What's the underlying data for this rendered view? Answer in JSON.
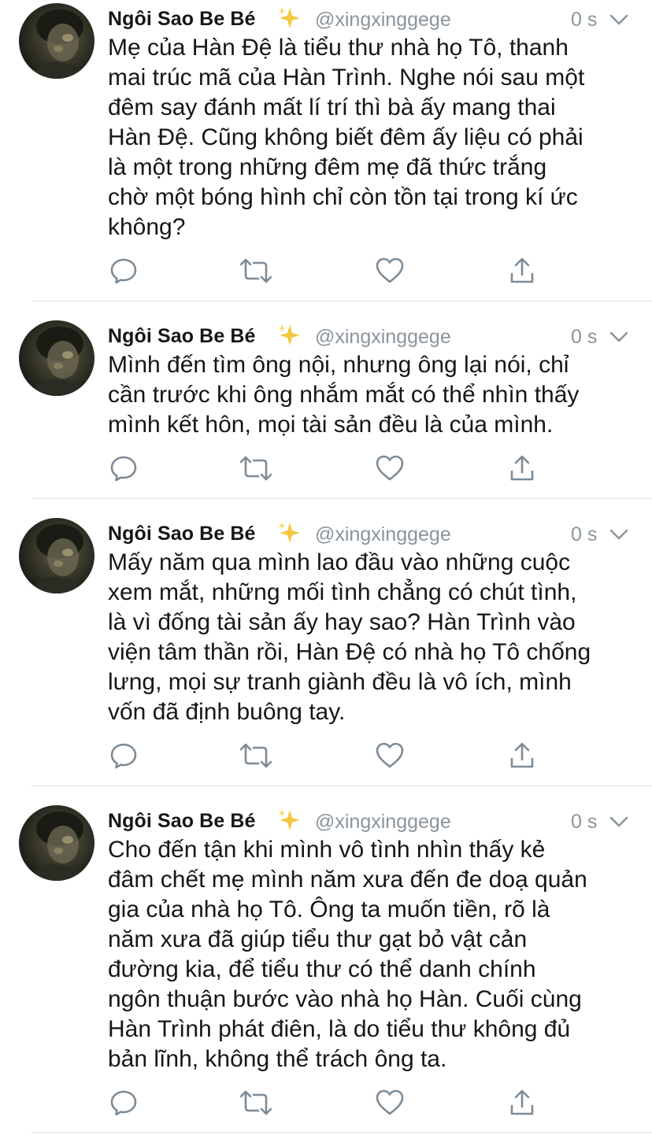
{
  "colors": {
    "text": "#14171a",
    "secondary": "#8a949c",
    "icon": "#7d8b97",
    "divider": "#dfe3e6"
  },
  "tweets": [
    {
      "name": "Ngôi Sao Be Bé",
      "emoji_icon": "sparkles-icon",
      "handle": "@xingxinggege",
      "time": "0 s",
      "text": "Mẹ của Hàn Đệ là tiểu thư nhà họ Tô, thanh\nmai trúc mã của Hàn Trình. Nghe nói sau một\nđêm say đánh mất lí trí thì bà ấy mang thai\nHàn Đệ. Cũng không biết đêm ấy liệu có phải\nlà một trong những đêm mẹ đã thức trắng\nchờ một bóng hình chỉ còn tồn tại trong kí ức\nkhông?"
    },
    {
      "name": "Ngôi Sao Be Bé",
      "emoji_icon": "sparkles-icon",
      "handle": "@xingxinggege",
      "time": "0 s",
      "text": "Mình đến tìm ông nội, nhưng ông lại nói, chỉ\ncần trước khi ông nhắm mắt có thể nhìn thấy\nmình kết hôn, mọi tài sản đều là của mình."
    },
    {
      "name": "Ngôi Sao Be Bé",
      "emoji_icon": "sparkles-icon",
      "handle": "@xingxinggege",
      "time": "0 s",
      "text": "Mấy năm qua mình lao đầu vào những cuộc\nxem mắt, những mối tình chẳng có chút tình,\nlà vì đống tài sản ấy hay sao? Hàn Trình vào\nviện tâm thần rồi, Hàn Đệ có nhà họ Tô chống\nlưng, mọi sự tranh giành đều là vô ích, mình\nvốn đã định buông tay."
    },
    {
      "name": "Ngôi Sao Be Bé",
      "emoji_icon": "sparkles-icon",
      "handle": "@xingxinggege",
      "time": "0 s",
      "text": "Cho đến tận khi mình vô tình nhìn thấy kẻ\nđâm chết mẹ mình năm xưa đến đe doạ quản\ngia của nhà họ Tô. Ông ta muốn tiền, rõ là\nnăm xưa đã giúp tiểu thư gạt bỏ vật cản\nđường kia, để tiểu thư có thể danh chính\nngôn thuận bước vào nhà họ Hàn. Cuối cùng\nHàn Trình phát điên, là do tiểu thư không đủ\nbản lĩnh, không thể trách ông ta."
    }
  ],
  "action_icons": [
    "reply-icon",
    "retweet-icon",
    "like-icon",
    "share-icon"
  ]
}
